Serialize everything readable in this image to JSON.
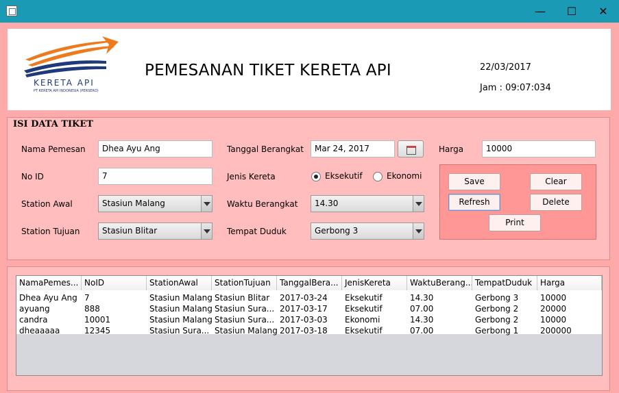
{
  "window": {
    "minimize": "—",
    "maximize": "☐",
    "close": "✕"
  },
  "header": {
    "logo_text": "KERETA API",
    "logo_subtext": "PT KERETA API INDONESIA (PERSERO)",
    "title": "PEMESANAN TIKET KERETA API",
    "date": "22/03/2017",
    "time": "Jam : 09:07:034"
  },
  "form": {
    "title": "ISI DATA TIKET",
    "nama_label": "Nama Pemesan",
    "nama_value": "Dhea Ayu Ang",
    "noid_label": "No ID",
    "noid_value": "7",
    "station_awal_label": "Station Awal",
    "station_awal_value": "Stasiun Malang",
    "station_tujuan_label": "Station Tujuan",
    "station_tujuan_value": "Stasiun Blitar",
    "tanggal_label": "Tanggal Berangkat",
    "tanggal_value": "Mar 24, 2017",
    "jenis_label": "Jenis Kereta",
    "jenis_opt1": "Eksekutif",
    "jenis_opt2": "Ekonomi",
    "waktu_label": "Waktu Berangkat",
    "waktu_value": "14.30",
    "tempat_label": "Tempat Duduk",
    "tempat_value": "Gerbong 3",
    "harga_label": "Harga",
    "harga_value": "10000"
  },
  "buttons": {
    "save": "Save",
    "clear": "Clear",
    "refresh": "Refresh",
    "delete": "Delete",
    "print": "Print"
  },
  "table": {
    "headers": [
      "NamaPemes...",
      "NoID",
      "StationAwal",
      "StationTujuan",
      "TanggalBera...",
      "JenisKereta",
      "WaktuBerang...",
      "TempatDuduk",
      "Harga"
    ],
    "rows": [
      [
        "Dhea Ayu Ang",
        "7",
        "Stasiun Malang",
        "Stasiun Blitar",
        "2017-03-24",
        "Eksekutif",
        "14.30",
        "Gerbong 3",
        "10000"
      ],
      [
        "ayuang",
        "888",
        "Stasiun Malang",
        "Stasiun Sura...",
        "2017-03-17",
        "Eksekutif",
        "07.00",
        "Gerbong 2",
        "20000"
      ],
      [
        "candra",
        "10001",
        "Stasiun Malang",
        "Stasiun Sura...",
        "2017-03-03",
        "Ekonomi",
        "14.30",
        "Gerbong 2",
        "10000"
      ],
      [
        "dheaaaaa",
        "12345",
        "Stasiun Sura...",
        "Stasiun Malang",
        "2017-03-18",
        "Eksekutif",
        "07.00",
        "Gerbong 1",
        "200000"
      ]
    ]
  }
}
